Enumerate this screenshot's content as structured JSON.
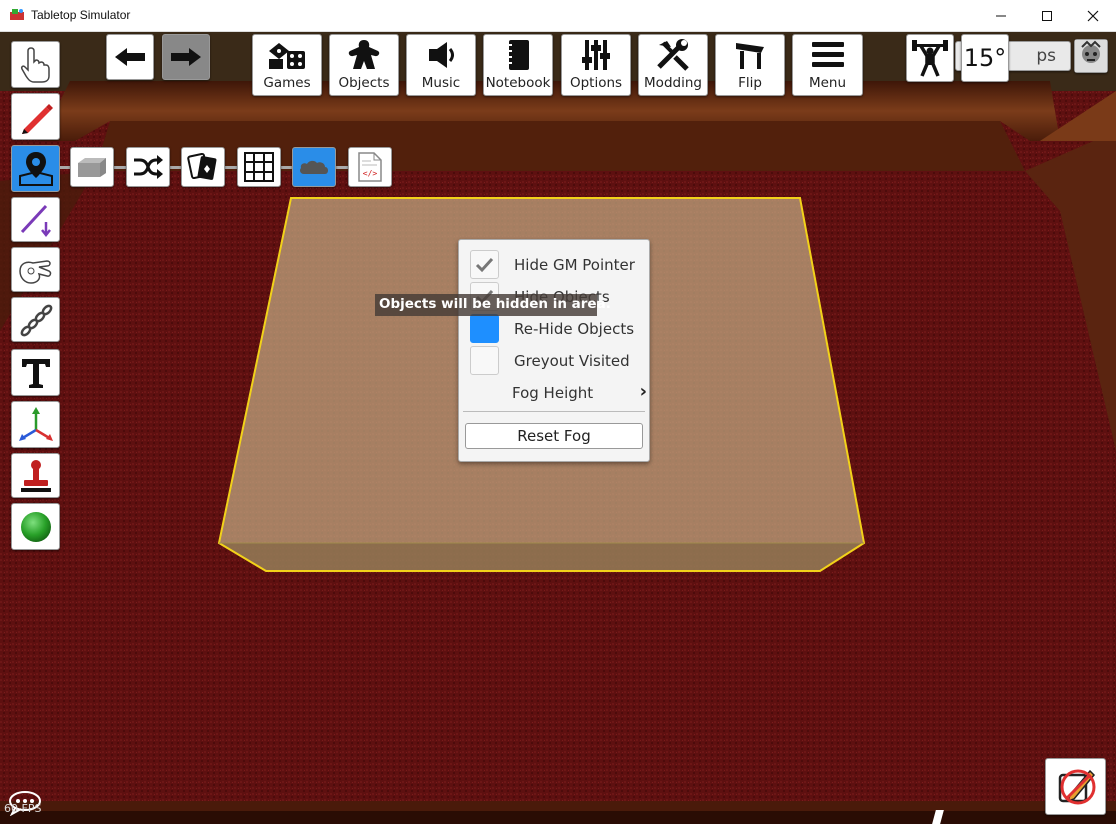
{
  "window": {
    "title": "Tabletop Simulator",
    "minimize": "—",
    "maximize": "☐",
    "close": "✕"
  },
  "nav": {
    "back_icon": "arrow-left",
    "forward_icon": "arrow-right"
  },
  "topbar": {
    "buttons": [
      {
        "label": "Games",
        "icon": "dice"
      },
      {
        "label": "Objects",
        "icon": "meeple"
      },
      {
        "label": "Music",
        "icon": "speaker"
      },
      {
        "label": "Notebook",
        "icon": "notebook"
      },
      {
        "label": "Options",
        "icon": "sliders"
      },
      {
        "label": "Modding",
        "icon": "tools"
      },
      {
        "label": "Flip",
        "icon": "table-flip"
      },
      {
        "label": "Menu",
        "icon": "hamburger"
      }
    ],
    "rotation_label": "15°",
    "partial_label": "ps"
  },
  "left_tools": [
    "pointer",
    "draw",
    "zone",
    "line",
    "gizmo",
    "joint",
    "text",
    "axis",
    "stamp",
    "color"
  ],
  "zone_subtools": [
    "layout-zone",
    "randomize-zone",
    "hand-zone",
    "snap-grid",
    "fog-of-war",
    "scripting-zone"
  ],
  "fog_menu": {
    "items": [
      {
        "label": "Hide GM Pointer",
        "checked": true,
        "highlight": false
      },
      {
        "label": "Hide Objects",
        "checked": true,
        "highlight": false
      },
      {
        "label": "Re-Hide Objects",
        "checked": false,
        "highlight": true
      },
      {
        "label": "Greyout Visited",
        "checked": false,
        "highlight": false
      }
    ],
    "fog_height": "Fog Height",
    "fog_height_arrow": "›",
    "reset_label": "Reset Fog"
  },
  "tooltip": "Objects will be hidden in area.",
  "status": {
    "fps": "60 FPS"
  },
  "colors": {
    "accent": "#2a8de8",
    "felt": "#5c0f0f",
    "fog_outline": "#f2d21a"
  }
}
